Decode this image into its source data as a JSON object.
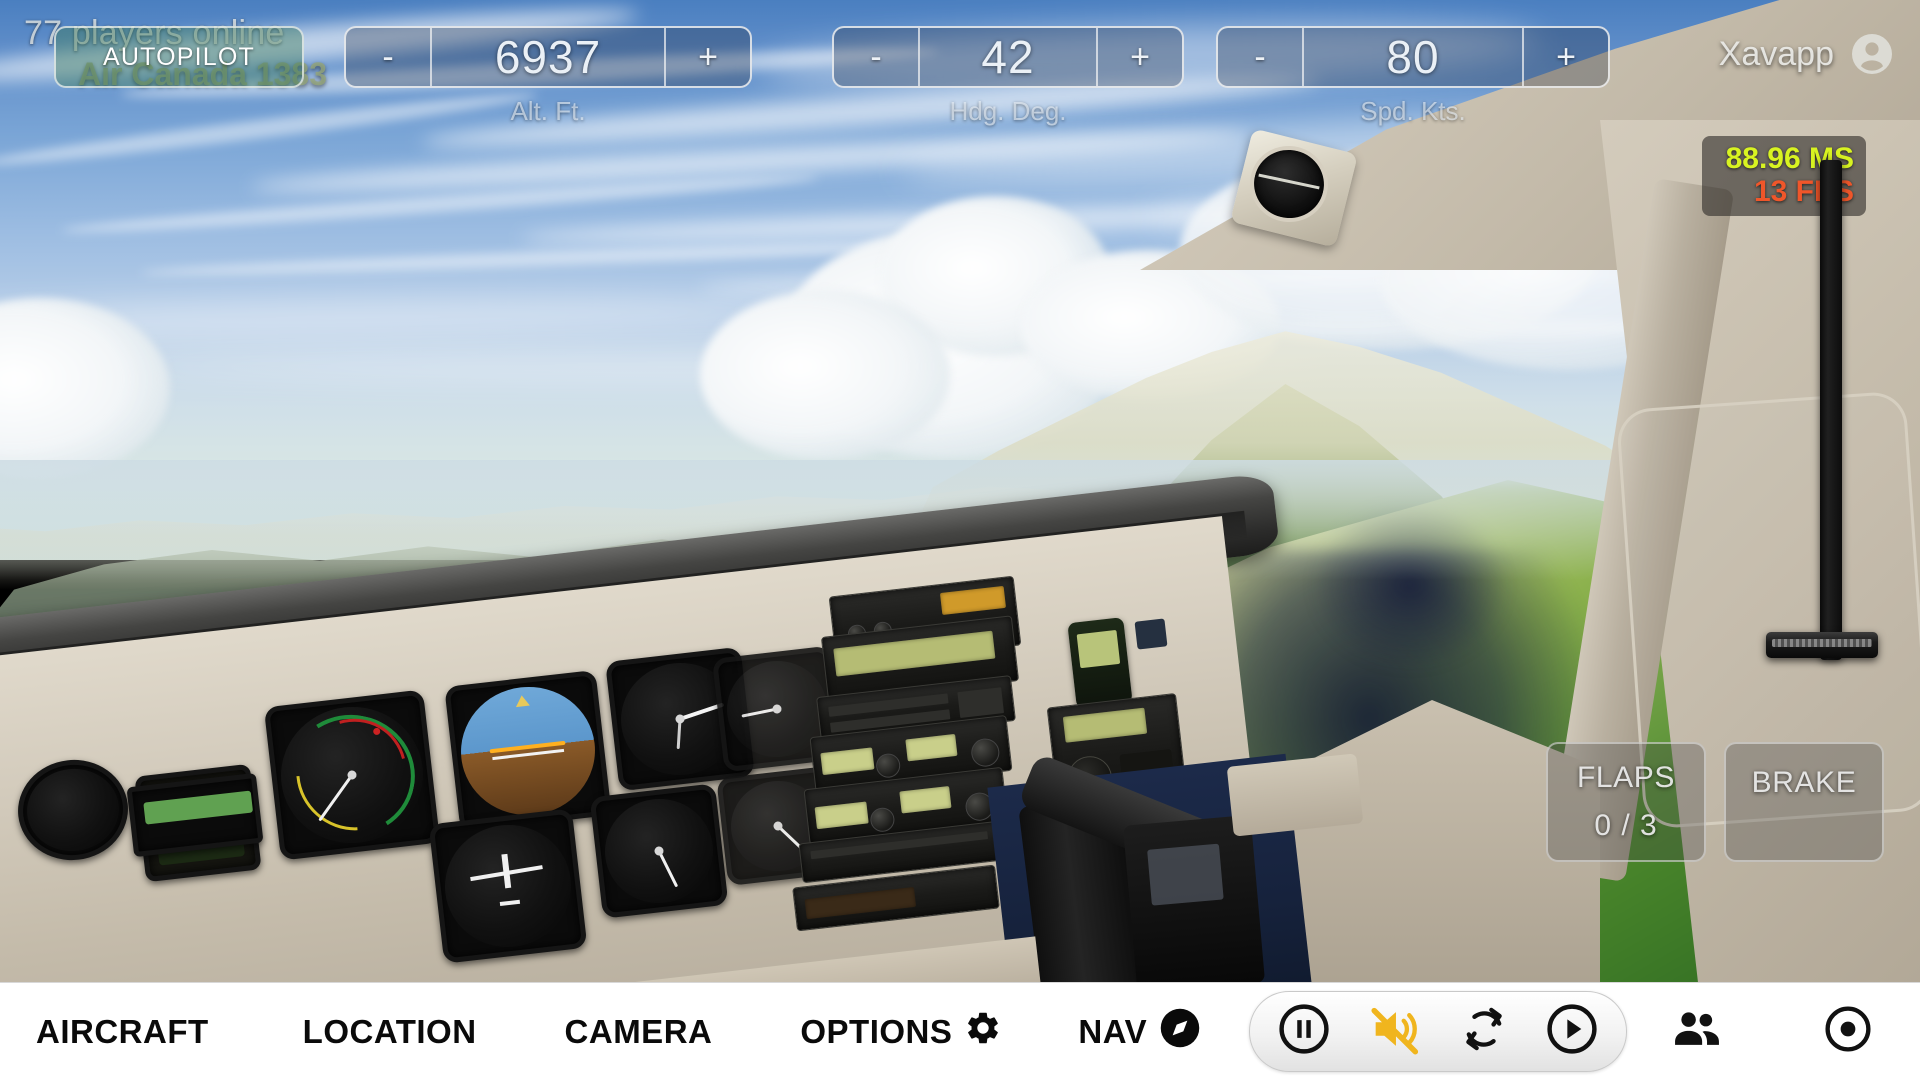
{
  "hud": {
    "players_online": "77 players online",
    "callsign": "Air Canada 1383",
    "autopilot_label": "AUTOPILOT",
    "username": "Xavapp",
    "account_icon": "account-circle-icon",
    "steppers": [
      {
        "id": "altitude",
        "minus": "-",
        "value": "6937",
        "plus": "+",
        "label": "Alt. Ft."
      },
      {
        "id": "heading",
        "minus": "-",
        "value": "42",
        "plus": "+",
        "label": "Hdg. Deg."
      },
      {
        "id": "speed",
        "minus": "-",
        "value": "80",
        "plus": "+",
        "label": "Spd. Kts."
      }
    ],
    "performance": {
      "ms": "88.96 MS",
      "fps": "13 FPS",
      "ms_color": "#d8f321",
      "fps_color": "#f0562a"
    },
    "flaps": {
      "label": "FLAPS",
      "value": "0 / 3"
    },
    "brake": {
      "label": "BRAKE"
    },
    "throttle": {
      "name": "throttle-lever"
    }
  },
  "toolbar": {
    "menu": [
      {
        "id": "aircraft",
        "label": "AIRCRAFT",
        "icon": null
      },
      {
        "id": "location",
        "label": "LOCATION",
        "icon": null
      },
      {
        "id": "camera",
        "label": "CAMERA",
        "icon": null
      },
      {
        "id": "options",
        "label": "OPTIONS",
        "icon": "gear-icon"
      },
      {
        "id": "nav",
        "label": "NAV",
        "icon": "compass-icon"
      }
    ],
    "transport": [
      {
        "id": "pause",
        "icon": "pause-circle-icon",
        "color": "#111111"
      },
      {
        "id": "mute",
        "icon": "speaker-muted-icon",
        "color": "#f0b51e"
      },
      {
        "id": "replay",
        "icon": "refresh-icon",
        "color": "#111111"
      },
      {
        "id": "play",
        "icon": "play-circle-icon",
        "color": "#111111"
      }
    ],
    "multiplayer": {
      "id": "multiplayer",
      "icon": "people-icon",
      "color": "#111111"
    },
    "record": {
      "id": "record",
      "icon": "record-dot-icon",
      "color": "#111111"
    }
  },
  "scene": {
    "description": "cockpit-view-over-green-mountains",
    "sky_color": "#6f9fd0",
    "terrain_color": "#4f7a33",
    "panel_color": "#d2cabb"
  }
}
